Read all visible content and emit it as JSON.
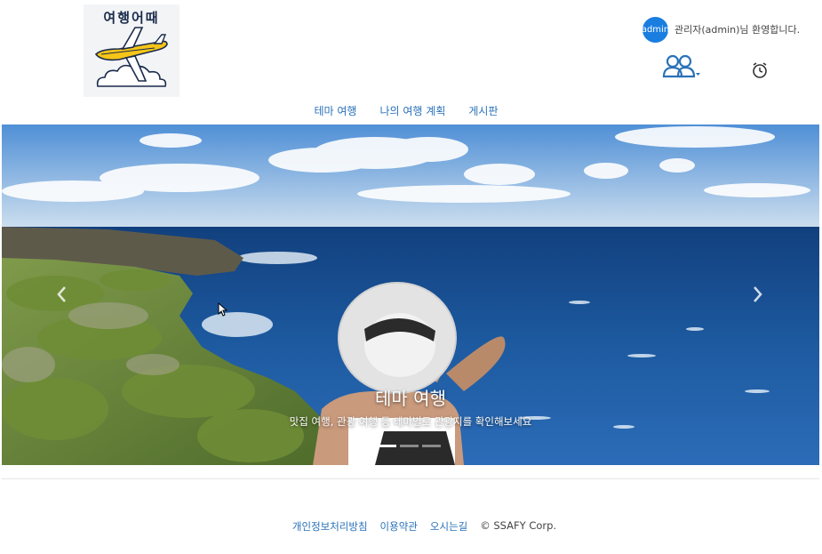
{
  "logo": {
    "text": "여행어때",
    "icon": "airplane-icon"
  },
  "user": {
    "avatar_label": "admin",
    "welcome": "관리자(admin)님 환영합니다."
  },
  "header_icons": {
    "users": "users-icon",
    "alarm": "alarm-clock-icon"
  },
  "nav": {
    "items": [
      "테마 여행",
      "나의 여행 계획",
      "게시판"
    ]
  },
  "carousel": {
    "title": "테마 여행",
    "text": "맛집 여행, 관광 여행 등 테마별로 관광지를 확인해보세요",
    "indicators": 3,
    "active_indicator": 0,
    "prev_icon": "chevron-left-icon",
    "next_icon": "chevron-right-icon"
  },
  "footer": {
    "links": [
      "개인정보처리방침",
      "이용약관",
      "오시는길"
    ],
    "copyright": "© SSAFY Corp."
  },
  "colors": {
    "link": "#2a72b8",
    "avatar": "#1a7ee0"
  }
}
